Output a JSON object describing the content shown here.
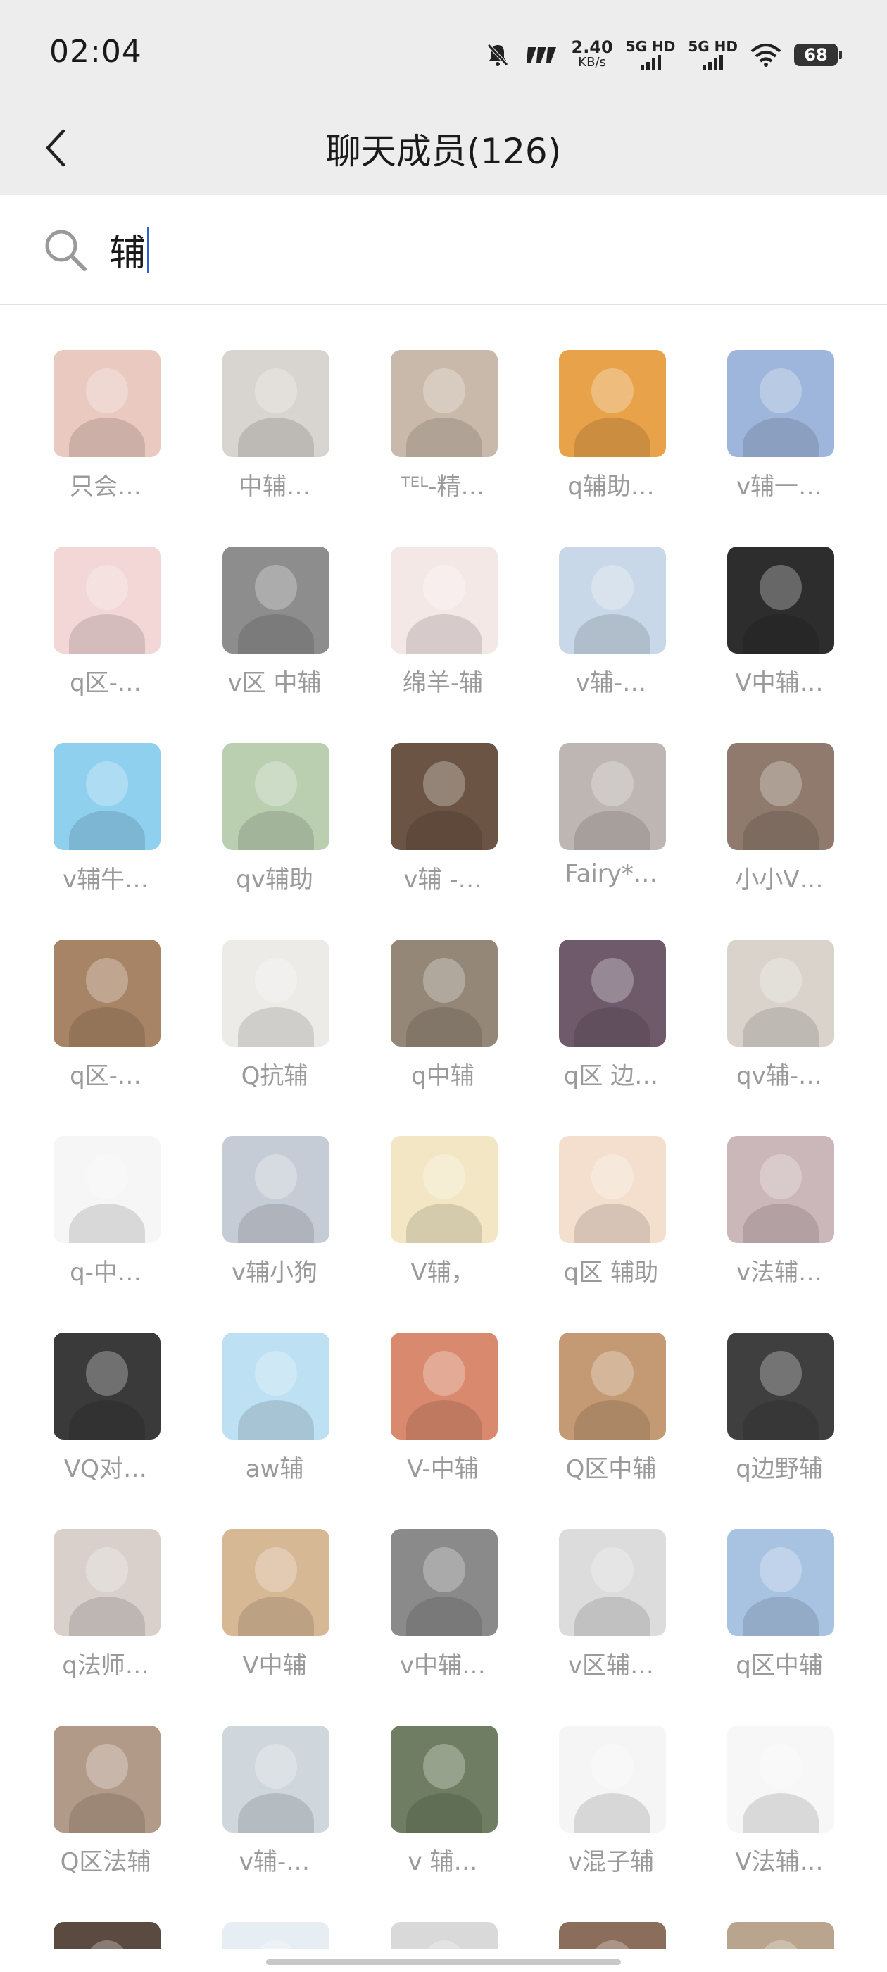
{
  "status_bar": {
    "time": "02:04",
    "speed_value": "2.40",
    "speed_unit": "KB/s",
    "signal1": "5G HD",
    "signal2": "5G HD",
    "battery": "68"
  },
  "nav": {
    "title": "聊天成员(126)"
  },
  "search": {
    "value": "辅"
  },
  "members": [
    {
      "name": "只会…",
      "color": "#e9c9c0"
    },
    {
      "name": "中辅…",
      "color": "#d8d4cf"
    },
    {
      "name": "ᵀᴱᴸ-精…",
      "color": "#c9b9aa"
    },
    {
      "name": "q辅助…",
      "color": "#e8a24a"
    },
    {
      "name": "v辅一…",
      "color": "#9fb6dc"
    },
    {
      "name": "q区-…",
      "color": "#f3d6d6"
    },
    {
      "name": "v区 中辅",
      "color": "#8d8d8d"
    },
    {
      "name": "绵羊-辅",
      "color": "#f4e8e6"
    },
    {
      "name": "v辅-…",
      "color": "#c9d8e8"
    },
    {
      "name": "V中辅…",
      "color": "#2d2d2d"
    },
    {
      "name": "v辅牛…",
      "color": "#8fd0ef"
    },
    {
      "name": "qv辅助",
      "color": "#b9cfb0"
    },
    {
      "name": "v辅 -…",
      "color": "#6b5443"
    },
    {
      "name": "Fairy*…",
      "color": "#bdb6b2"
    },
    {
      "name": "小小V…",
      "color": "#8f7a6d"
    },
    {
      "name": "q区-…",
      "color": "#a88466"
    },
    {
      "name": "Q抗辅",
      "color": "#ecebe8"
    },
    {
      "name": "q中辅",
      "color": "#948778"
    },
    {
      "name": "q区 边…",
      "color": "#6f5a6c"
    },
    {
      "name": "qv辅-…",
      "color": "#d9d3cb"
    },
    {
      "name": "q-中…",
      "color": "#f6f6f6"
    },
    {
      "name": "v辅小狗",
      "color": "#c6ccd6"
    },
    {
      "name": "V辅，",
      "color": "#f2e6c4"
    },
    {
      "name": "q区 辅助",
      "color": "#f4dfcf"
    },
    {
      "name": "v法辅…",
      "color": "#cbb7b9"
    },
    {
      "name": "VQ对…",
      "color": "#3a3a3a"
    },
    {
      "name": "aw辅",
      "color": "#bde0f2"
    },
    {
      "name": "V-中辅",
      "color": "#d98a6e"
    },
    {
      "name": "Q区中辅",
      "color": "#c49a74"
    },
    {
      "name": "q边野辅",
      "color": "#3f3f3f"
    },
    {
      "name": "q法师…",
      "color": "#d9d0cc"
    },
    {
      "name": "V中辅",
      "color": "#d7b895"
    },
    {
      "name": "v中辅…",
      "color": "#8a8a8a"
    },
    {
      "name": "v区辅…",
      "color": "#dcdcdc"
    },
    {
      "name": "q区中辅",
      "color": "#a8c3e2"
    },
    {
      "name": "Q区法辅",
      "color": "#b29a88"
    },
    {
      "name": "v辅-…",
      "color": "#cfd6dc"
    },
    {
      "name": "v  辅…",
      "color": "#6f7e62"
    },
    {
      "name": "v混子辅",
      "color": "#f5f5f5"
    },
    {
      "name": "V法辅…",
      "color": "#f7f7f7"
    },
    {
      "name": "",
      "color": "#5b4a40"
    },
    {
      "name": "",
      "color": "#e6eef4"
    },
    {
      "name": "",
      "color": "#d9d9d9"
    },
    {
      "name": "",
      "color": "#8a6d5a"
    },
    {
      "name": "",
      "color": "#b9a58e"
    }
  ]
}
